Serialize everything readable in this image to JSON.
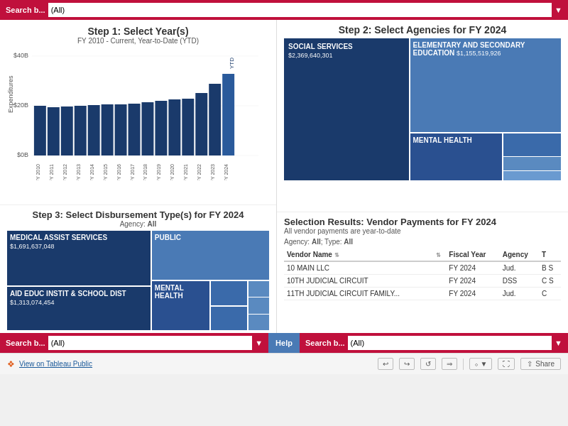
{
  "topbar": {
    "search_label": "Search b...",
    "search_value": "(All)"
  },
  "step1": {
    "title": "Step 1: Select Year(s)",
    "subtitle": "FY 2010 - Current, Year-to-Date (YTD)",
    "y_labels": [
      "$40B",
      "$20B",
      "$0B"
    ],
    "bars": [
      {
        "label": "FY 2010",
        "height": 0.5
      },
      {
        "label": "FY 2011",
        "height": 0.48
      },
      {
        "label": "FY 2012",
        "height": 0.49
      },
      {
        "label": "FY 2013",
        "height": 0.5
      },
      {
        "label": "FY 2014",
        "height": 0.5
      },
      {
        "label": "FY 2015",
        "height": 0.51
      },
      {
        "label": "FY 2016",
        "height": 0.51
      },
      {
        "label": "FY 2017",
        "height": 0.52
      },
      {
        "label": "FY 2018",
        "height": 0.54
      },
      {
        "label": "FY 2019",
        "height": 0.55
      },
      {
        "label": "FY 2020",
        "height": 0.56
      },
      {
        "label": "FY 2021",
        "height": 0.57
      },
      {
        "label": "FY 2022",
        "height": 0.62
      },
      {
        "label": "FY 2023",
        "height": 0.72
      },
      {
        "label": "FY 2024",
        "height": 0.82,
        "ytd": true
      }
    ],
    "ytd_label": "YTD",
    "x_label": "Expenditures"
  },
  "step2": {
    "title": "Step 2: Select Agencies for FY 2024",
    "cells": [
      {
        "name": "SOCIAL SERVICES",
        "value": "$2,369,640,301"
      },
      {
        "name": "ELEMENTARY AND SECONDARY EDUCATION",
        "value": "$1,155,519,926"
      },
      {
        "name": "MENTAL HEALTH",
        "value": ""
      }
    ]
  },
  "step3": {
    "title": "Step 3: Select Disbursement Type(s) for FY 2024",
    "subtitle": "Agency: All",
    "cells": [
      {
        "name": "MEDICAL ASSIST SERVICES",
        "value": "$1,691,637,048"
      },
      {
        "name": "PUBLIC",
        "value": ""
      },
      {
        "name": "MENTAL HEALTH",
        "value": ""
      },
      {
        "name": "AID EDUC INSTIT & SCHOOL DIST",
        "value": "$1,313,074,454"
      }
    ]
  },
  "results": {
    "title": "Selection Results: Vendor Payments for FY 2024",
    "subtitle1": "All vendor payments are year-to-date",
    "subtitle2": "Agency: All; Type: All",
    "columns": [
      "Vendor Name",
      "",
      "Fiscal Year",
      "Agency",
      "T"
    ],
    "rows": [
      {
        "vendor": "10 MAIN LLC",
        "fy": "FY 2024",
        "agency": "Jud.",
        "type": "B S"
      },
      {
        "vendor": "10TH JUDICIAL CIRCUIT",
        "fy": "FY 2024",
        "agency": "DSS",
        "type": "C S"
      },
      {
        "vendor": "11TH JUDICIAL CIRCUIT FAMILY...",
        "fy": "FY 2024",
        "agency": "Jud.",
        "type": "C"
      }
    ]
  },
  "bottombar": {
    "left_label": "Search b...",
    "left_value": "(All)",
    "help_label": "Help",
    "right_label": "Search b...",
    "right_value": "(All)"
  },
  "footer": {
    "tableau_label": "View on Tableau Public",
    "share_label": "Share"
  }
}
